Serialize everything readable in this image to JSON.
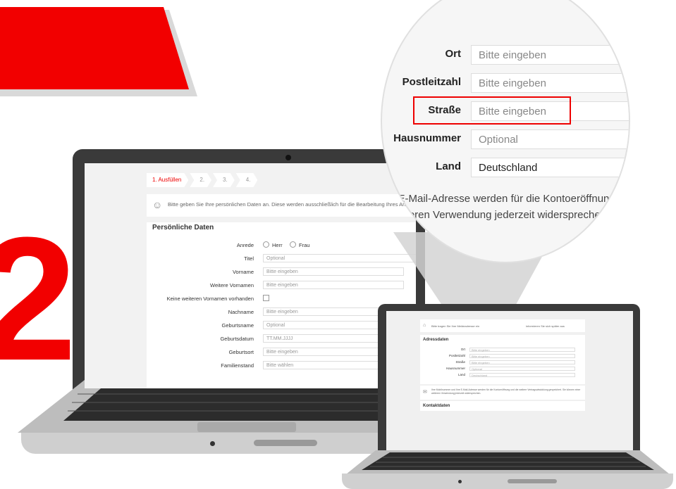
{
  "main_form": {
    "steps": [
      "1. Ausfüllen",
      "2.",
      "3.",
      "4."
    ],
    "info_text": "Bitte geben Sie Ihre persönlichen Daten an. Diese werden ausschließlich für die Bearbeitung Ihres Antrag",
    "section_title": "Persönliche Daten",
    "anrede_label": "Anrede",
    "anrede_options": [
      "Herr",
      "Frau"
    ],
    "fields": [
      {
        "label": "Titel",
        "placeholder": "Optional"
      },
      {
        "label": "Vorname",
        "placeholder": "Bitte eingeben",
        "help": "?"
      },
      {
        "label": "Weitere Vornamen",
        "placeholder": "Bitte eingeben",
        "help": "?"
      },
      {
        "label": "Keine weiteren Vornamen vorhanden"
      },
      {
        "label": "Nachname",
        "placeholder": "Bitte eingeben"
      },
      {
        "label": "Geburtsname",
        "placeholder": "Optional"
      },
      {
        "label": "Geburtsdatum",
        "placeholder": "TT.MM.JJJJ"
      },
      {
        "label": "Geburtsort",
        "placeholder": "Bitte eingeben"
      },
      {
        "label": "Familienstand",
        "placeholder": "Bitte wählen"
      }
    ]
  },
  "magnifier": {
    "fields": [
      {
        "label": "Ort",
        "placeholder": "Bitte eingeben"
      },
      {
        "label": "Postleitzahl",
        "placeholder": "Bitte eingeben"
      },
      {
        "label": "Straße",
        "placeholder": "Bitte eingeben"
      },
      {
        "label": "Hausnummer",
        "placeholder": "Optional"
      },
      {
        "label": "Land",
        "value": "Deutschland"
      }
    ],
    "text_line1": "e E-Mail-Adresse werden für die Kontoeröffnung",
    "text_line2": "eiteren Verwendung jederzeit widerspreche"
  },
  "small_form": {
    "info_text": "Bitte tragen Sie Ihre Meldeadresse ein",
    "info_text_right": "informieren Sie sich später aus",
    "section_title": "Adressdaten",
    "fields": [
      {
        "label": "Ort",
        "placeholder": "Bitte eingeben"
      },
      {
        "label": "Postleitzahl",
        "placeholder": "Bitte eingeben"
      },
      {
        "label": "Straße",
        "placeholder": "Bitte eingeben"
      },
      {
        "label": "Hausnummer",
        "placeholder": "Optional"
      },
      {
        "label": "Land",
        "value": "Deutschland"
      }
    ],
    "notice_text": "Ihre Mobilnummer und Ihre E-Mail-Adresse werden für die Kontoeröffnung und die weitere Vertragsabwicklung gespeichert. Sie können einer weiteren Verwendung jederzeit widersprechen.",
    "contact_title": "Kontaktdaten"
  },
  "decor": {
    "step_digit": "2",
    "brand_color": "#f20000"
  }
}
